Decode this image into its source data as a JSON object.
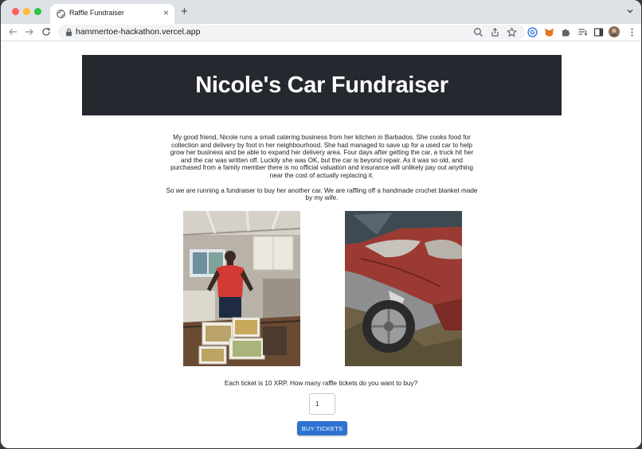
{
  "browser": {
    "tab_title": "Raffle Fundraiser",
    "url": "hammertoe-hackathon.vercel.app"
  },
  "page": {
    "title": "Nicole's Car Fundraiser",
    "story_paragraph_1": "My good friend, Nicole runs a small catering business from her kitchen in Barbados. She cooks food for collection and delivery by foot in her neighbourhood. She had managed to save up for a used car to help grow her business and be able to expand her delivery area. Four days after getting the car, a truck hit her and the car was written off. Luckily she was OK, but the car is beyond repair. As it was so old, and purchased from a family member there is no official valuation and insurance will unlikely pay out anything near the cost of actually replacing it.",
    "story_paragraph_2": "So we are running a fundraiser to buy her another car. We are raffling off a handmade crochet blanket made by my wife.",
    "ticket_question": "Each ticket is 10 XRP. How many raffle tickets do you want to buy?",
    "ticket_quantity": "1",
    "buy_button_label": "BUY TICKETS"
  },
  "colors": {
    "banner_bg": "#25282e",
    "button_bg": "#2e72d2"
  }
}
